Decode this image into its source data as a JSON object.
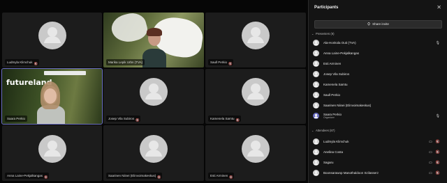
{
  "tiles": [
    {
      "name": "Ludmyla Klimchuk",
      "muted": true
    },
    {
      "name": "Marika Lepik Urbn (TVA)",
      "muted": false
    },
    {
      "name": "Saull Perkio",
      "muted": true
    },
    {
      "name": "Saara Perkio",
      "muted": false
    },
    {
      "name": "Josep Vila Subiros",
      "muted": true
    },
    {
      "name": "Kamenela Samtu",
      "muted": true
    },
    {
      "name": "Anna Laine-Pekjalkangas",
      "muted": true
    },
    {
      "name": "Saarinen Niinei (Elinvoimakeskus)",
      "muted": true
    },
    {
      "name": "Esti Arminen",
      "muted": true
    }
  ],
  "video_logo": "futureland",
  "panel": {
    "title": "Participants",
    "close": "✕",
    "share_label": "Share invite",
    "share_icon": "⛭",
    "in_meeting_label": "Presenters (9)",
    "attendees_label": "Attendees (87)",
    "in_meeting": [
      {
        "name": "Ala-Honkola Outi (TVA)",
        "role": ""
      },
      {
        "name": "Anna Laine-Pekjalkangas",
        "role": ""
      },
      {
        "name": "Esti Arminen",
        "role": ""
      },
      {
        "name": "Josep Vila Subiros",
        "role": ""
      },
      {
        "name": "Kamenela Samtu",
        "role": ""
      },
      {
        "name": "Saull Perkio",
        "role": ""
      },
      {
        "name": "Saarinen Niinei (Elinvoimakeskus)",
        "role": ""
      },
      {
        "name": "Saara Perkio",
        "role": "Organizer"
      }
    ],
    "attendees": [
      {
        "name": "Ludmyla Klimchuk"
      },
      {
        "name": "Anelina Costa"
      },
      {
        "name": "Sagaru"
      },
      {
        "name": "Boonsarawop Manothaldoon Szilasserz"
      }
    ]
  },
  "colors": {
    "accent": "#6b6fc4"
  }
}
